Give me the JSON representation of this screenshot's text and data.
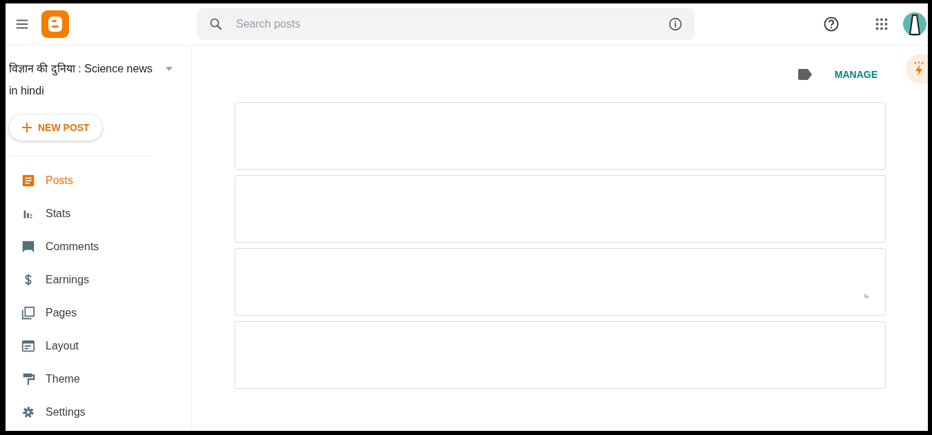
{
  "header": {
    "search": {
      "placeholder": "Search posts"
    }
  },
  "sidebar": {
    "blog_title": "विज्ञान की दुनिया : Science news in hindi",
    "new_post": "NEW POST",
    "items": [
      {
        "label": "Posts",
        "selected": true
      },
      {
        "label": "Stats",
        "selected": false
      },
      {
        "label": "Comments",
        "selected": false
      },
      {
        "label": "Earnings",
        "selected": false
      },
      {
        "label": "Pages",
        "selected": false
      },
      {
        "label": "Layout",
        "selected": false
      },
      {
        "label": "Theme",
        "selected": false
      },
      {
        "label": "Settings",
        "selected": false
      }
    ]
  },
  "toolbar": {
    "manage": "MANAGE"
  }
}
